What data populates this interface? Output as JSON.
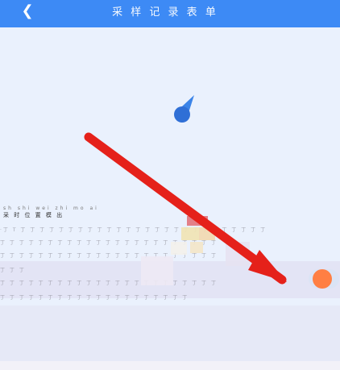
{
  "header": {
    "back_icon": "chevron-left-icon",
    "title": "采 样 记 录 表 单"
  },
  "row_label": {
    "pinyin": "sh  shi  wei  zhi  mo  ai",
    "hanzi": "采 时 位 置 模 出"
  },
  "colors": {
    "header_bg": "#3d8af5",
    "map_bg": "#eaf1fd",
    "arrow": "#e5211a",
    "toggle_knob": "#ff7f43",
    "location_pin": "#2f6fd6"
  }
}
